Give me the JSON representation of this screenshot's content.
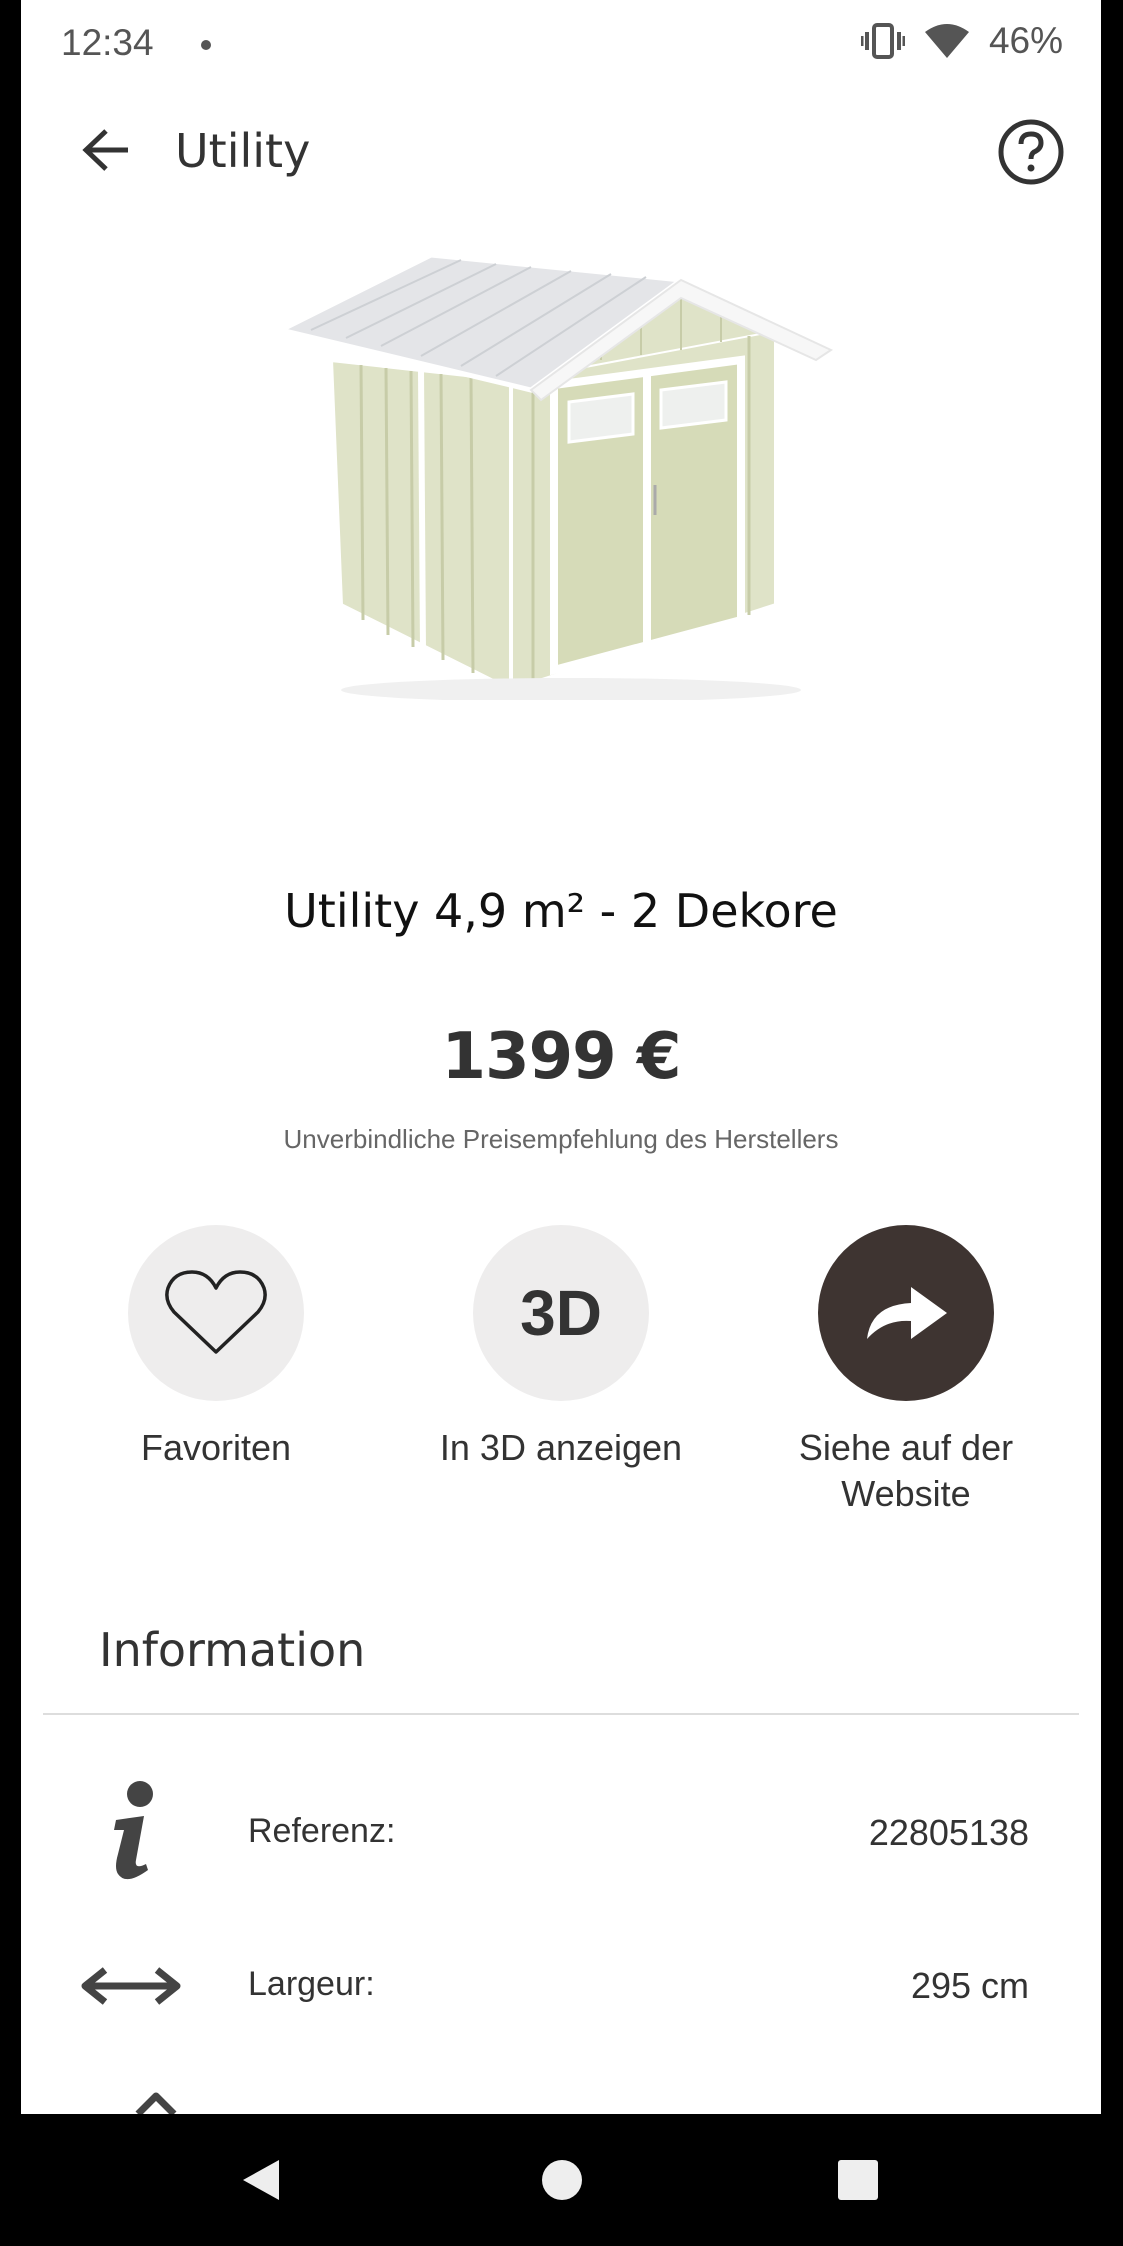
{
  "status_bar": {
    "time": "12:34",
    "battery": "46%"
  },
  "app_bar": {
    "title": "Utility"
  },
  "product": {
    "name": "Utility 4,9 m² - 2 Dekore",
    "price": "1399 €",
    "price_note": "Unverbindliche Preisempfehlung des Herstellers"
  },
  "actions": {
    "favorites_label": "Favoriten",
    "view3d_glyph": "3D",
    "view3d_label": "In 3D anzeigen",
    "website_label_line1": "Siehe auf der",
    "website_label_line2": "Website"
  },
  "information": {
    "title": "Information",
    "rows": [
      {
        "key": "Referenz:",
        "value": "22805138",
        "icon": "info-icon"
      },
      {
        "key": "Largeur:",
        "value": "295 cm",
        "icon": "width-arrows-icon"
      }
    ]
  },
  "colors": {
    "accent_dark": "#3e3431",
    "circle_bg": "#eeeded"
  }
}
